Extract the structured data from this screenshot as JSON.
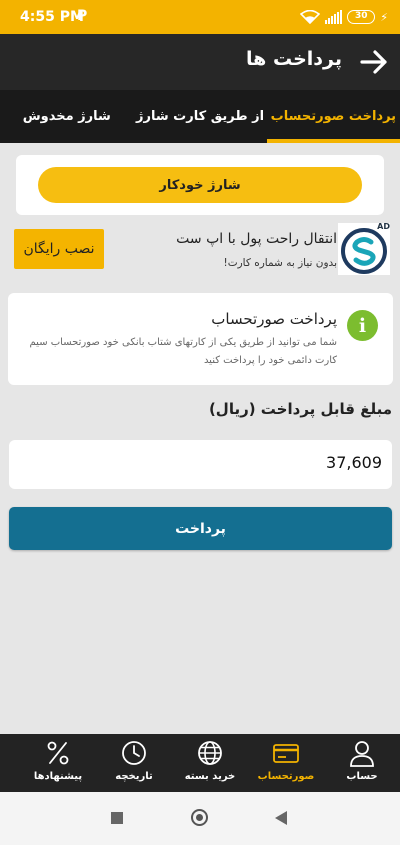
{
  "status_bar": {
    "time": "4:55 PM",
    "carrier_icon": "P",
    "battery": "30"
  },
  "app_bar": {
    "title": "پرداخت ها"
  },
  "tabs": [
    {
      "label": "پرداخت صورتحساب",
      "active": true
    },
    {
      "label": "از طریق کارت شارژ",
      "active": false
    },
    {
      "label": "شارژ مخدوش",
      "active": false
    }
  ],
  "auto_charge": {
    "label": "شارژ خودکار"
  },
  "ad": {
    "title": "انتقال راحت پول با اپ ست",
    "subtitle": "بدون نیاز به شماره کارت!",
    "install_label": "نصب رایگان",
    "tag": "AD"
  },
  "info": {
    "title": "پرداخت صورتحساب",
    "description": "شما می توانید از طریق یکی از کارتهای شتاب بانکی خود صورتحساب سیم کارت دائمی خود را پرداخت کنید"
  },
  "amount": {
    "label": "مبلغ قابل پرداخت (ریال)",
    "value": "37,609"
  },
  "pay_button": {
    "label": "پرداخت"
  },
  "bottom_nav": [
    {
      "label": "حساب",
      "icon": "user-icon",
      "active": false
    },
    {
      "label": "صورتحساب",
      "icon": "credit-card-icon",
      "active": true
    },
    {
      "label": "خرید بسته",
      "icon": "globe-icon",
      "active": false
    },
    {
      "label": "تاریخچه",
      "icon": "clock-icon",
      "active": false
    },
    {
      "label": "پیشنهادها",
      "icon": "percent-icon",
      "active": false
    }
  ],
  "colors": {
    "accent": "#f3b300",
    "primary_button": "#146f91",
    "info_icon": "#7cbd2f",
    "dark_bar": "#272727"
  }
}
